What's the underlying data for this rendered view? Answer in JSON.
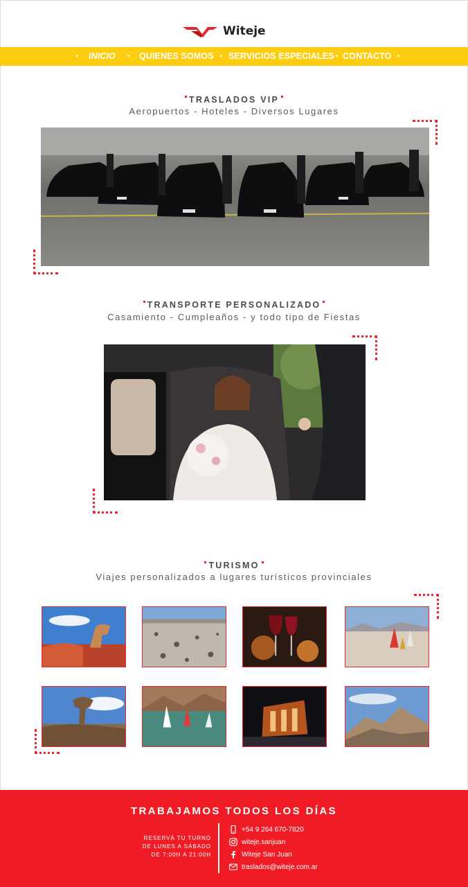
{
  "brand": {
    "name": "Witeje",
    "accent": "#ef1c25",
    "nav_color": "#fecd0f"
  },
  "nav": {
    "items": [
      "INICIO",
      "QUIENES SOMOS",
      "SERVICIOS ESPECIALES",
      "CONTACTO"
    ],
    "active": "INICIO"
  },
  "sections": {
    "vip": {
      "title": "TRASLADOS VIP",
      "subtitle": "Aeropuertos - Hoteles - Diversos Lugares",
      "image": "black-cars-with-chauffeurs-photo"
    },
    "transporte": {
      "title": "TRANSPORTE PERSONALIZADO",
      "subtitle": "Casamiento - Cumpleaños - y todo tipo de Fiestas",
      "image": "bride-in-classic-car-photo"
    },
    "turismo": {
      "title": "TURISMO",
      "subtitle": "Viajes personalizados a lugares turísticos provinciales",
      "thumbnails": [
        "red-rock-formation-photo",
        "stone-field-photo",
        "wine-glasses-photo",
        "land-sailing-photo",
        "mushroom-rock-photo",
        "windsurf-lake-photo",
        "night-building-photo",
        "mountain-landscape-photo"
      ]
    }
  },
  "footer": {
    "title": "TRABAJAMOS TODOS LOS DÍAS",
    "schedule": [
      "RESERVÁ TU TURNO",
      "DE LUNES A SÁBADO",
      "DE 7:00H A 21:00H"
    ],
    "contacts": [
      {
        "icon": "phone-icon",
        "text": "+54 9 264 670-7820"
      },
      {
        "icon": "instagram-icon",
        "text": "witeje.sanjuan"
      },
      {
        "icon": "facebook-icon",
        "text": "Witeje San Juan"
      },
      {
        "icon": "mail-icon",
        "text": "traslados@witeje.com.ar"
      }
    ]
  }
}
